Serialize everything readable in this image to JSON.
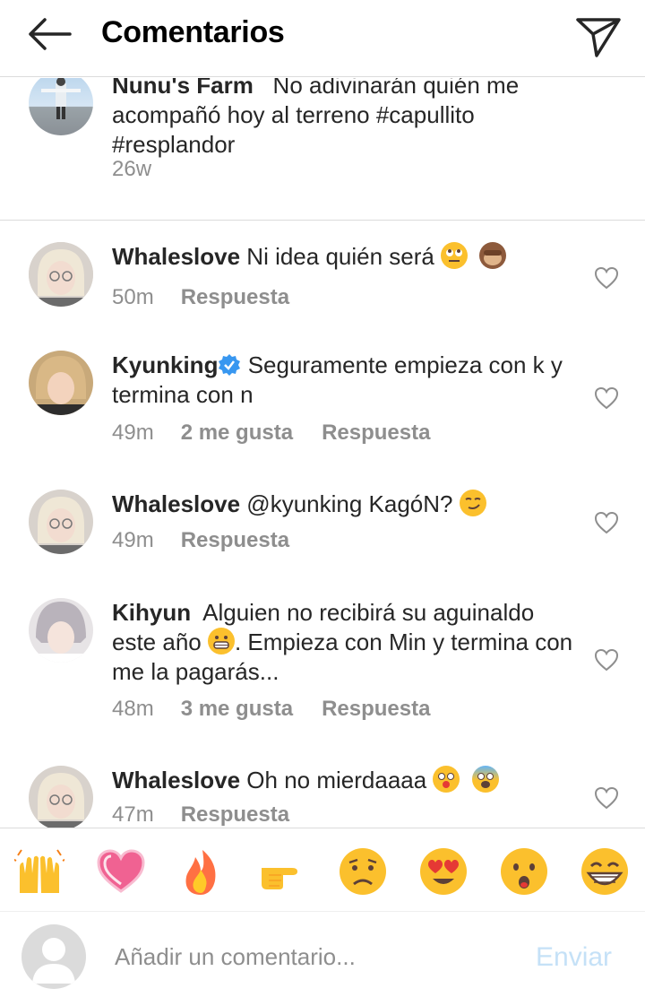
{
  "header": {
    "title": "Comentarios"
  },
  "caption": {
    "username": "Nunu's Farm",
    "text": "No adivinarán quién me acompañó hoy al terreno #capullito #resplandor",
    "time": "26w"
  },
  "comments": [
    {
      "username": "Whaleslove",
      "text": "Ni idea quién será",
      "time": "50m",
      "likes": "",
      "reply": "Respuesta",
      "emojis": [
        "rolling-eyes-emoji",
        "see-no-evil-monkey-emoji"
      ]
    },
    {
      "username": "Kyunking",
      "verified": true,
      "text": "Seguramente empieza con k y termina con n",
      "time": "49m",
      "likes": "2 me gusta",
      "reply": "Respuesta"
    },
    {
      "username": "Whaleslove",
      "text": "@kyunking KagóN?",
      "time": "49m",
      "likes": "",
      "reply": "Respuesta",
      "emojis": [
        "smirk-emoji"
      ]
    },
    {
      "username": "Kihyun",
      "text_part1": "Alguien no recibirá su aguinaldo este año",
      "text_part2": ". Empieza con Min y termina con me la pagarás...",
      "time": "48m",
      "likes": "3 me gusta",
      "reply": "Respuesta",
      "emojis": [
        "grimacing-emoji"
      ]
    },
    {
      "username": "Whaleslove",
      "text": "Oh no mierdaaaa",
      "time": "47m",
      "likes": "",
      "reply": "Respuesta",
      "emojis": [
        "fearful-emoji",
        "screaming-emoji"
      ]
    }
  ],
  "reactions": [
    "raising-hands-emoji",
    "pink-heart-emoji",
    "fire-emoji",
    "pointing-hand-emoji",
    "worried-face-emoji",
    "heart-eyes-emoji",
    "surprised-face-emoji",
    "grinning-emoji"
  ],
  "composer": {
    "placeholder": "Añadir un comentario...",
    "post_label": "Enviar"
  },
  "colors": {
    "accent_disabled": "#c5e1f7",
    "secondary_text": "#8e8e8e",
    "verified": "#3897f0",
    "emoji_yellow": "#fbc02d"
  }
}
